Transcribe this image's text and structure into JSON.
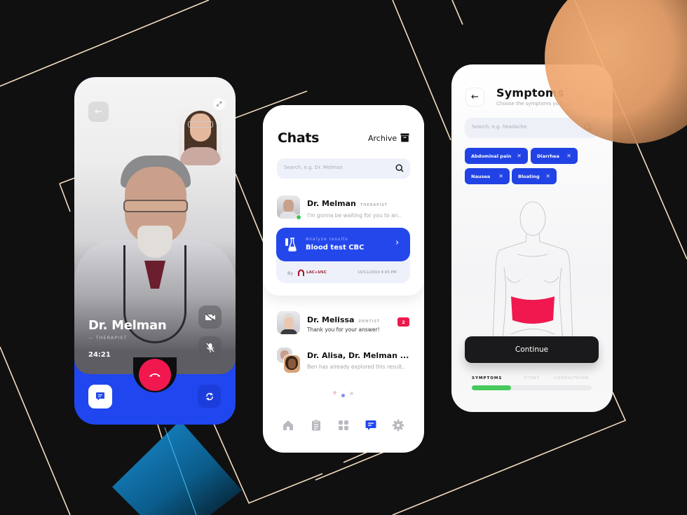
{
  "call_screen": {
    "doctor_name": "Dr. Melman",
    "doctor_role": "— THERAPIST",
    "timer": "24:21",
    "icons": {
      "back": "arrow-left-icon",
      "expand": "expand-icon",
      "camera_off": "video-off-icon",
      "mic_off": "mic-off-icon",
      "hangup": "phone-hangup-icon",
      "chat": "chat-bubble-icon",
      "switch_camera": "switch-camera-icon"
    },
    "colors": {
      "accent": "#2046f0",
      "hangup": "#f0184f"
    }
  },
  "chats_screen": {
    "title": "Chats",
    "archive_label": "Archive",
    "search_placeholder": "Search, e.g. Dr. Melman",
    "conversations": [
      {
        "name": "Dr. Melman",
        "role": "THERAPIST",
        "message": "I'm gonna be waiting for you to an..",
        "online": true,
        "attachment": {
          "subtitle": "Analyze results",
          "title": "Blood test CBC",
          "by_label": "By",
          "org": "LAC+USC",
          "date": "10/11/2019 4:43 PM"
        }
      },
      {
        "name": "Dr. Melissa",
        "role": "DENTIST",
        "message": "Thank you for your answer!",
        "unread": "2"
      },
      {
        "name": "Dr. Alisa, Dr. Melman ...",
        "role": "",
        "message": "Ben has already explored this result.."
      }
    ],
    "pagination": {
      "total": 3,
      "active": 1
    },
    "tabbar": [
      {
        "icon": "home-icon",
        "active": false
      },
      {
        "icon": "clipboard-icon",
        "active": false
      },
      {
        "icon": "grid-icon",
        "active": false
      },
      {
        "icon": "chat-icon",
        "active": true
      },
      {
        "icon": "settings-gear-icon",
        "active": false
      }
    ],
    "colors": {
      "accent": "#2447ec",
      "badge": "#ec1a4c",
      "online": "#3fc655"
    }
  },
  "symptoms_screen": {
    "title": "Symptoms",
    "subtitle": "Choose the symptoms you feel",
    "search_placeholder": "Search, e.g. headache",
    "chips": [
      "Abdominal pain",
      "Diarrhea",
      "Nausea",
      "Bloating"
    ],
    "highlighted_region": "abdomen",
    "continue_label": "Continue",
    "steps": [
      "SYMPTOMS",
      "STORY",
      "CONSULTAION"
    ],
    "active_step": 0,
    "progress_fraction": 0.33,
    "colors": {
      "chip": "#2143e5",
      "highlight": "#f0184f",
      "progress": "#47c95c"
    }
  }
}
